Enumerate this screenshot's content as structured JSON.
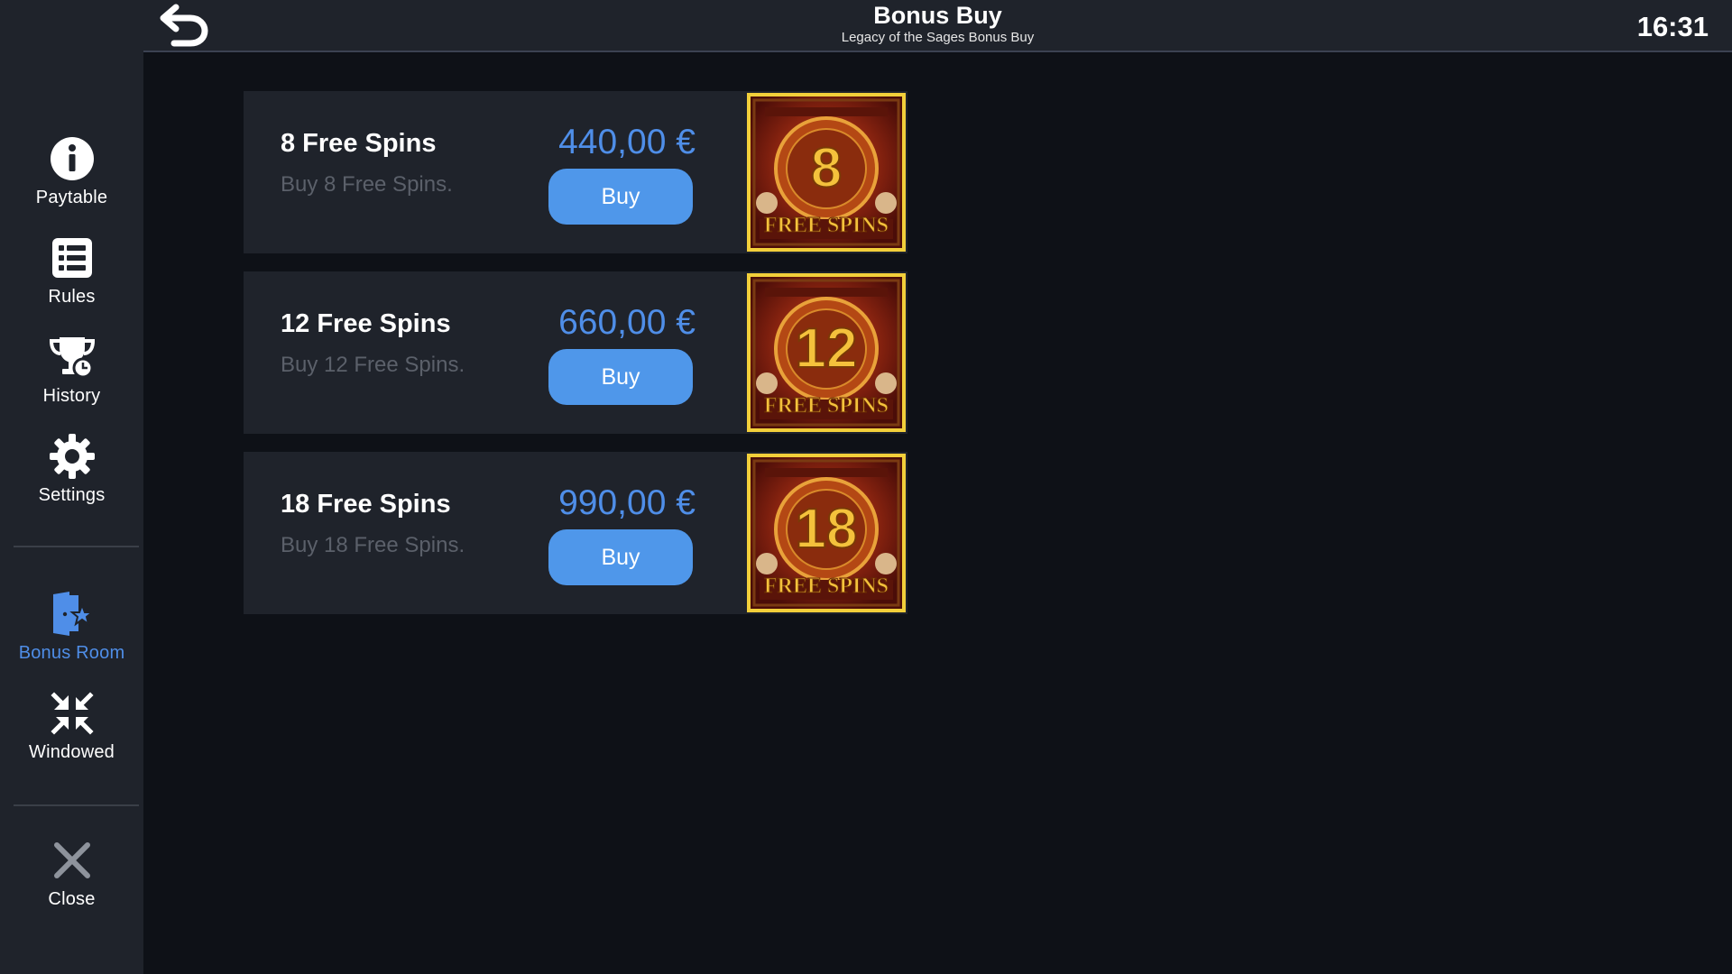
{
  "header": {
    "title": "Bonus Buy",
    "subtitle": "Legacy of the Sages Bonus Buy",
    "clock": "16:31"
  },
  "sidebar": {
    "items": [
      {
        "label": "Paytable",
        "icon": "info-icon"
      },
      {
        "label": "Rules",
        "icon": "list-icon"
      },
      {
        "label": "History",
        "icon": "trophy-clock-icon"
      },
      {
        "label": "Settings",
        "icon": "gear-icon"
      },
      {
        "label": "Bonus Room",
        "icon": "door-star-icon",
        "active": true
      },
      {
        "label": "Windowed",
        "icon": "compress-icon"
      },
      {
        "label": "Close",
        "icon": "close-icon"
      }
    ]
  },
  "offers": [
    {
      "title": "8 Free Spins",
      "description": "Buy 8 Free Spins.",
      "price": "440,00 €",
      "button": "Buy",
      "image_number": "8",
      "image_text": "FREE SPINS"
    },
    {
      "title": "12 Free Spins",
      "description": "Buy 12 Free Spins.",
      "price": "660,00 €",
      "button": "Buy",
      "image_number": "12",
      "image_text": "FREE SPINS"
    },
    {
      "title": "18 Free Spins",
      "description": "Buy 18 Free Spins.",
      "price": "990,00 €",
      "button": "Buy",
      "image_number": "18",
      "image_text": "FREE SPINS"
    }
  ],
  "colors": {
    "accent": "#4f8ee8",
    "button": "#4f97ea",
    "panel": "#1f232b",
    "background": "#0e1117",
    "image_border": "#f2cf3a"
  }
}
